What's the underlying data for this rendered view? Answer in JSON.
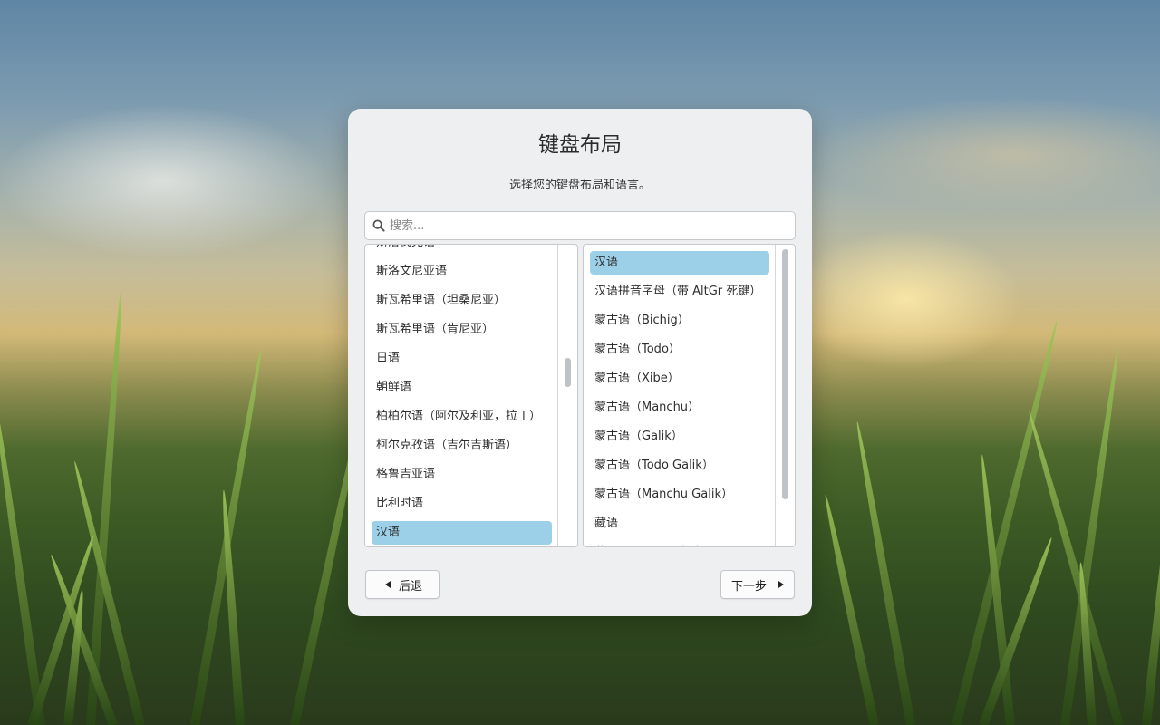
{
  "dialog": {
    "title": "键盘布局",
    "subtitle": "选择您的键盘布局和语言。"
  },
  "search": {
    "placeholder": "搜索..."
  },
  "languages": {
    "items": [
      "斯洛伐克语",
      "斯洛文尼亚语",
      "斯瓦希里语（坦桑尼亚）",
      "斯瓦希里语（肯尼亚）",
      "日语",
      "朝鲜语",
      "柏柏尔语（阿尔及利亚，拉丁）",
      "柯尔克孜语（吉尔吉斯语）",
      "格鲁吉亚语",
      "比利时语",
      "汉语"
    ],
    "selected": "汉语"
  },
  "layouts": {
    "items": [
      "汉语",
      "汉语拼音字母（带 AltGr 死键）",
      "蒙古语（Bichig）",
      "蒙古语（Todo）",
      "蒙古语（Xibe）",
      "蒙古语（Manchu）",
      "蒙古语（Galik）",
      "蒙古语（Todo Galik）",
      "蒙古语（Manchu Galik）",
      "藏语",
      "藏语（带 ASCII 数字）"
    ],
    "selected": "汉语"
  },
  "buttons": {
    "back_label": "后退",
    "next_label": "下一步"
  },
  "colors": {
    "selection": "#9ccfe8",
    "dialog_bg": "#eeeff0"
  }
}
